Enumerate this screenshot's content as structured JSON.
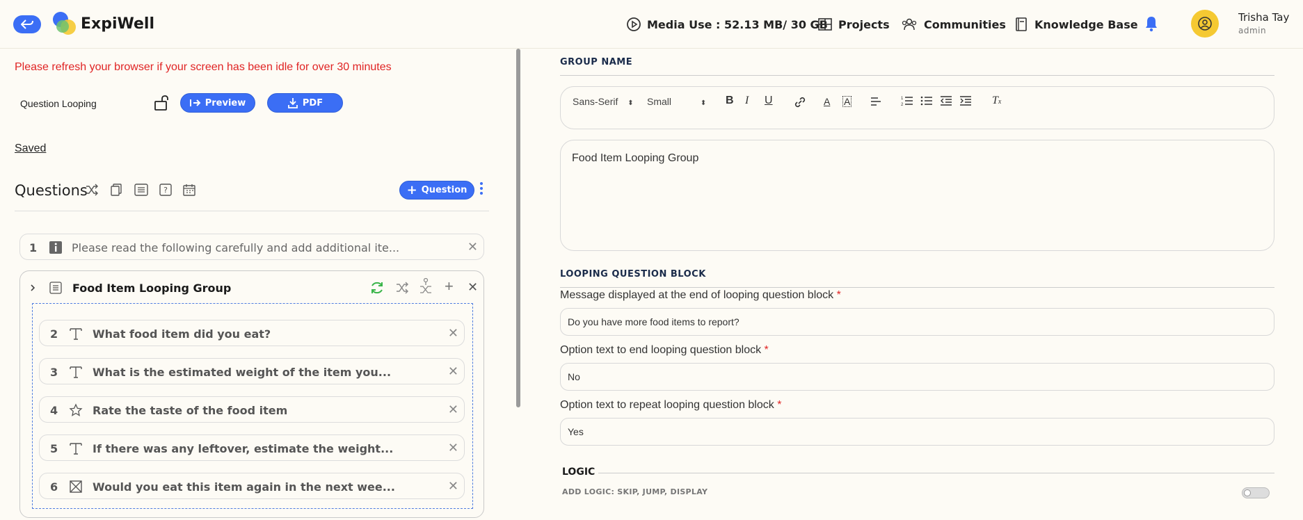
{
  "header": {
    "brand": "ExpiWell",
    "media_use": "Media Use : 52.13 MB/ 30 GB",
    "projects": "Projects",
    "communities": "Communities",
    "knowledge_base": "Knowledge Base",
    "user_name": "Trisha Tay",
    "user_role": "admin",
    "accent_color": "#3b6ef5",
    "avatar_color": "#f5c932"
  },
  "left": {
    "warning": "Please refresh your browser if your screen has been idle for over 30 minutes",
    "survey_name": "Question Looping",
    "preview_label": "Preview",
    "pdf_label": "PDF",
    "saved_label": "Saved",
    "questions_title": "Questions",
    "add_question_label": "Question"
  },
  "questions": [
    {
      "num": "1",
      "icon": "info-icon",
      "text": "Please read the following carefully and add additional ite..."
    }
  ],
  "group": {
    "title": "Food Item Looping Group",
    "items": [
      {
        "num": "2",
        "icon": "text-icon",
        "text": "What food item did you eat?"
      },
      {
        "num": "3",
        "icon": "text-icon",
        "text": "What is the estimated weight of the item you..."
      },
      {
        "num": "4",
        "icon": "star-icon",
        "text": "Rate the taste of the food item"
      },
      {
        "num": "5",
        "icon": "text-icon",
        "text": "If there was any leftover, estimate the weight..."
      },
      {
        "num": "6",
        "icon": "checkbox-icon",
        "text": "Would you eat this item again in the next wee..."
      }
    ]
  },
  "right": {
    "group_name_label": "GROUP NAME",
    "font_select": "Sans-Serif",
    "size_select": "Small",
    "group_name_value": "Food Item Looping Group",
    "looping_label": "LOOPING QUESTION BLOCK",
    "end_message_label": "Message displayed at the end of looping question block",
    "end_message_value": "Do you have more food items to report?",
    "end_option_label": "Option text to end looping question block",
    "end_option_value": "No",
    "repeat_option_label": "Option text to repeat looping question block",
    "repeat_option_value": "Yes",
    "required_mark": "*",
    "logic_label": "LOGIC",
    "logic_sub": "ADD LOGIC: SKIP, JUMP, DISPLAY"
  }
}
